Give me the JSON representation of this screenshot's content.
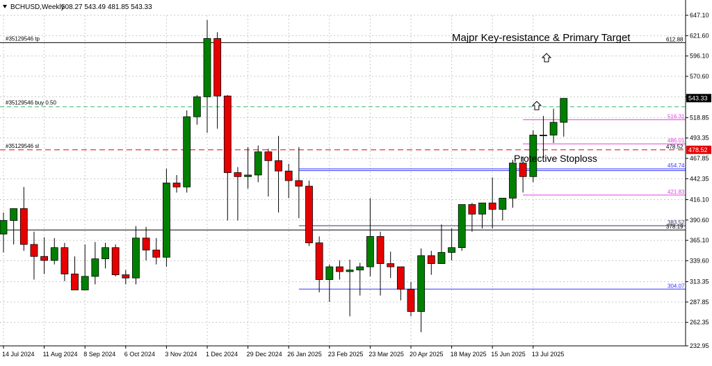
{
  "header": {
    "symbol": "BCHUSD,Weekly",
    "ohlc": "508.27 543.49 481.85 543.33"
  },
  "colors": {
    "up": "#008000",
    "down": "#e60000",
    "grid": "#c8c8c8",
    "tp_line": "#000000",
    "buy_line": "#3cb371",
    "sl_line": "#e60000",
    "blue_line": "#3333ff",
    "magenta_line": "#e040e0",
    "dark_line": "#333366"
  },
  "chart_data": {
    "type": "candlestick",
    "ylim": [
      232.95,
      647.1
    ],
    "y_ticks": [
      "647.10",
      "621.60",
      "596.10",
      "570.60",
      "544.85",
      "518.85",
      "493.35",
      "467.85",
      "442.35",
      "416.10",
      "390.60",
      "365.10",
      "339.60",
      "313.35",
      "287.85",
      "262.35",
      "232.95"
    ],
    "x_labels": [
      "14 Jul 2024",
      "11 Aug 2024",
      "8 Sep 2024",
      "6 Oct 2024",
      "3 Nov 2024",
      "1 Dec 2024",
      "29 Dec 2024",
      "26 Jan 2025",
      "23 Feb 2025",
      "23 Mar 2025",
      "20 Apr 2025",
      "18 May 2025",
      "15 Jun 2025",
      "13 Jul 2025"
    ],
    "candles": [
      [
        373,
        400,
        350,
        390
      ],
      [
        390,
        402,
        360,
        405
      ],
      [
        405,
        432,
        352,
        360
      ],
      [
        360,
        376,
        316,
        345
      ],
      [
        345,
        369,
        323,
        340
      ],
      [
        340,
        368,
        335,
        356
      ],
      [
        356,
        362,
        314,
        323
      ],
      [
        323,
        345,
        305,
        303
      ],
      [
        303,
        360,
        318,
        320
      ],
      [
        320,
        363,
        310,
        342
      ],
      [
        342,
        362,
        330,
        356
      ],
      [
        356,
        360,
        320,
        322
      ],
      [
        322,
        328,
        310,
        318
      ],
      [
        318,
        383,
        310,
        368
      ],
      [
        368,
        382,
        340,
        353
      ],
      [
        353,
        368,
        335,
        344
      ],
      [
        344,
        455,
        332,
        437
      ],
      [
        437,
        447,
        425,
        432
      ],
      [
        432,
        528,
        425,
        520
      ],
      [
        520,
        547,
        510,
        545
      ],
      [
        545,
        641,
        500,
        618
      ],
      [
        618,
        626,
        505,
        546
      ],
      [
        546,
        547,
        390,
        450
      ],
      [
        450,
        457,
        390,
        445
      ],
      [
        445,
        482,
        430,
        447
      ],
      [
        447,
        484,
        438,
        476
      ],
      [
        476,
        480,
        420,
        465
      ],
      [
        465,
        496,
        400,
        452
      ],
      [
        452,
        461,
        418,
        440
      ],
      [
        440,
        482,
        393,
        433
      ],
      [
        433,
        440,
        358,
        362
      ],
      [
        362,
        370,
        300,
        316
      ],
      [
        316,
        335,
        288,
        332
      ],
      [
        332,
        340,
        316,
        326
      ],
      [
        326,
        341,
        270,
        328
      ],
      [
        328,
        337,
        296,
        332
      ],
      [
        332,
        418,
        320,
        370
      ],
      [
        370,
        376,
        296,
        336
      ],
      [
        336,
        351,
        318,
        332
      ],
      [
        332,
        332,
        290,
        304
      ],
      [
        304,
        313,
        270,
        276
      ],
      [
        276,
        355,
        250,
        346
      ],
      [
        346,
        352,
        322,
        336
      ],
      [
        336,
        385,
        338,
        350
      ],
      [
        350,
        380,
        340,
        356
      ],
      [
        356,
        391,
        352,
        410
      ],
      [
        410,
        412,
        376,
        398
      ],
      [
        398,
        410,
        380,
        412
      ],
      [
        412,
        444,
        380,
        404
      ],
      [
        404,
        416,
        390,
        418
      ],
      [
        418,
        466,
        406,
        462
      ],
      [
        462,
        470,
        425,
        445
      ],
      [
        445,
        503,
        438,
        497
      ],
      [
        497,
        521,
        468,
        497
      ],
      [
        497,
        530,
        487,
        513
      ],
      [
        513,
        530,
        495,
        543
      ]
    ],
    "h_lines": [
      {
        "value": 612.88,
        "name": "#35129546 tp",
        "label": "612.88",
        "style": "tp"
      },
      {
        "value": 532.5,
        "name": "#35129546 buy 0.50",
        "label": "",
        "style": "buy"
      },
      {
        "value": 478.52,
        "name": "#35129546 sl",
        "label": "478.52",
        "style": "sl"
      },
      {
        "value": 378.19,
        "name": "",
        "label": "378.19",
        "style": "dark"
      }
    ],
    "segments": [
      {
        "from": 51,
        "value": 516.31,
        "label": "516.31",
        "style": "magenta"
      },
      {
        "from": 51,
        "value": 486.01,
        "label": "486.01",
        "style": "magenta"
      },
      {
        "from": 51,
        "value": 421.83,
        "label": "421.83",
        "style": "magenta"
      },
      {
        "from": 29,
        "value": 454.74,
        "label": "454.74",
        "style": "blue"
      },
      {
        "from": 29,
        "value": 452.5,
        "label": "",
        "style": "blue"
      },
      {
        "from": 29,
        "value": 383.52,
        "label": "383.52",
        "style": "dark"
      },
      {
        "from": 29,
        "value": 304.07,
        "label": "304.07",
        "style": "blue"
      }
    ],
    "current_price": "543.33",
    "current_value": 543.33,
    "sl_badge": "478.52",
    "annotations": {
      "target_text": "Majpr Key-resistance & Primary Target",
      "stoploss_text": "Protective Stoploss"
    }
  }
}
